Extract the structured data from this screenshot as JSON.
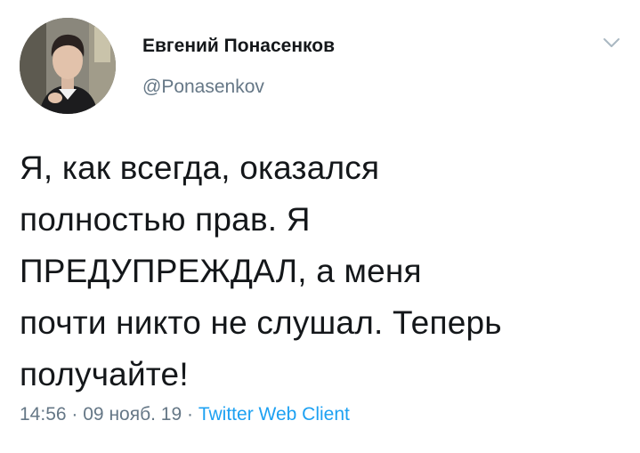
{
  "tweet": {
    "author": {
      "display_name": "Евгений Понасенков",
      "handle": "@Ponasenkov"
    },
    "text": "Я, как всегда, оказался\nполностью прав. Я\nПРЕДУПРЕЖДАЛ, а меня\nпочти никто не слушал. Теперь\nполучайте!",
    "time": "14:56",
    "date": "09 нояб. 19",
    "separator": "·",
    "source": "Twitter Web Client"
  },
  "icons": {
    "more": "chevron-down-icon"
  },
  "colors": {
    "text": "#14171a",
    "secondary": "#657786",
    "link": "#1da1f2",
    "background": "#ffffff"
  }
}
